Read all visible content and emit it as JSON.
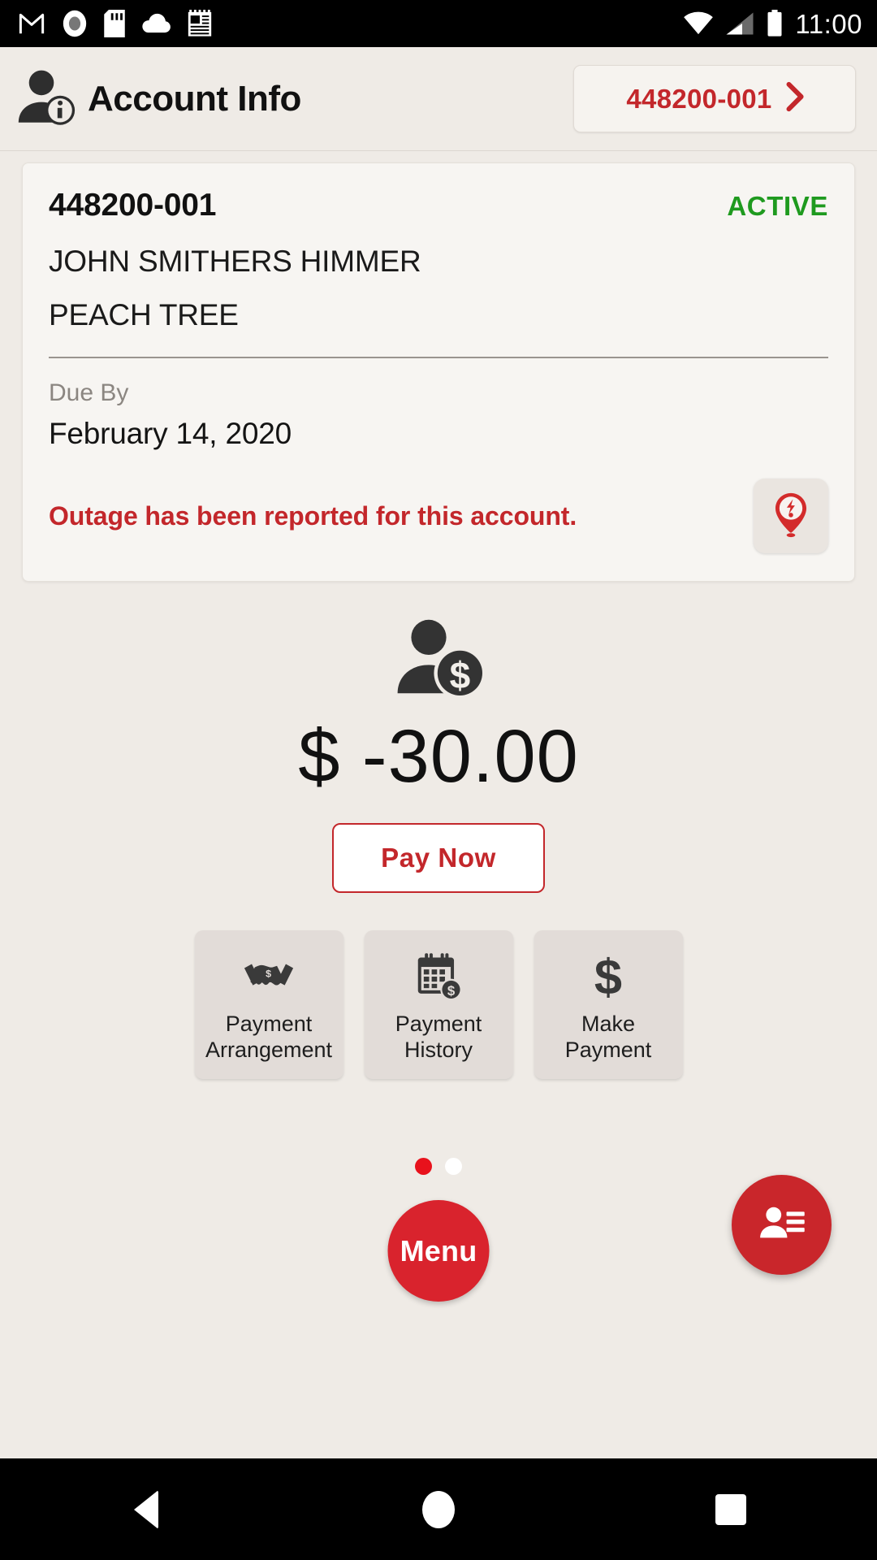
{
  "status_bar": {
    "time": "11:00",
    "left_icons": [
      "gmail-icon",
      "record-icon",
      "sd-card-icon",
      "cloud-icon",
      "news-icon"
    ],
    "right_icons": [
      "wifi-icon",
      "cellular-signal-icon",
      "battery-icon"
    ]
  },
  "header": {
    "icon": "account-info-icon",
    "title": "Account Info",
    "account_chip": {
      "label": "448200-001",
      "chevron": "chevron-right-icon"
    }
  },
  "account_card": {
    "account_number": "448200-001",
    "status": "ACTIVE",
    "status_color": "#1F9A1F",
    "customer_name": "JOHN SMITHERS HIMMER",
    "service_location": "PEACH TREE",
    "due_by_label": "Due By",
    "due_by_date": "February 14, 2020",
    "outage_message": "Outage has been reported for this account.",
    "outage_color": "#C3272B",
    "outage_icon": "outage-pin-icon"
  },
  "balance": {
    "icon": "customer-balance-icon",
    "amount": "$ -30.00",
    "pay_now_label": "Pay Now",
    "accent_color": "#C3272B"
  },
  "tiles": [
    {
      "icon": "handshake-dollar-icon",
      "line1": "Payment",
      "line2": "Arrangement"
    },
    {
      "icon": "calendar-dollar-icon",
      "line1": "Payment",
      "line2": "History"
    },
    {
      "icon": "dollar-sign-icon",
      "line1": "Make",
      "line2": "Payment"
    }
  ],
  "pagination": {
    "total": 2,
    "active_index": 0,
    "active_color": "#E8121C",
    "inactive_color": "#FFFFFF"
  },
  "menu_fab": {
    "label": "Menu",
    "color": "#D9232D"
  },
  "contact_fab": {
    "icon": "contact-card-icon",
    "color": "#C9262B"
  },
  "nav_bar": {
    "back": "back-triangle-icon",
    "home": "home-circle-icon",
    "recents": "recents-square-icon"
  }
}
